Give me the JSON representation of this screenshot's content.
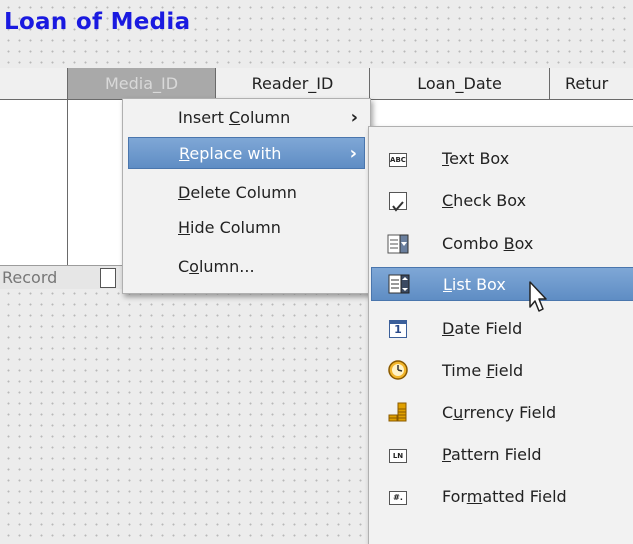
{
  "title": "Loan of Media",
  "grid": {
    "columns": [
      "Media_ID",
      "Reader_ID",
      "Loan_Date",
      "Retur"
    ],
    "record_label": "Record"
  },
  "context_menu": {
    "items": [
      {
        "label_pre": "Insert ",
        "key": "C",
        "label_post": "olumn",
        "has_submenu": true
      },
      {
        "label_pre": "",
        "key": "R",
        "label_post": "eplace with",
        "has_submenu": true
      },
      {
        "label_pre": "",
        "key": "D",
        "label_post": "elete Column",
        "has_submenu": false
      },
      {
        "label_pre": "",
        "key": "H",
        "label_post": "ide Column",
        "has_submenu": false
      },
      {
        "label_pre": "C",
        "key": "o",
        "label_post": "lumn...",
        "has_submenu": false
      }
    ]
  },
  "submenu": {
    "items": [
      {
        "icon": "text-box-icon",
        "label_pre": "",
        "key": "T",
        "label_post": "ext Box"
      },
      {
        "icon": "check-box-icon",
        "label_pre": "",
        "key": "C",
        "label_post": "heck Box"
      },
      {
        "icon": "combo-box-icon",
        "label_pre": "Combo ",
        "key": "B",
        "label_post": "ox"
      },
      {
        "icon": "list-box-icon",
        "label_pre": "",
        "key": "L",
        "label_post": "ist Box"
      },
      {
        "icon": "date-field-icon",
        "label_pre": "",
        "key": "D",
        "label_post": "ate Field"
      },
      {
        "icon": "time-field-icon",
        "label_pre": "Time ",
        "key": "F",
        "label_post": "ield"
      },
      {
        "icon": "currency-field-icon",
        "label_pre": "C",
        "key": "u",
        "label_post": "rrency Field"
      },
      {
        "icon": "pattern-field-icon",
        "label_pre": "",
        "key": "P",
        "label_post": "attern Field"
      },
      {
        "icon": "formatted-field-icon",
        "label_pre": "For",
        "key": "m",
        "label_post": "atted Field"
      }
    ]
  },
  "icon_text": {
    "text_box": "ABC",
    "date": "1",
    "pattern": "LN",
    "formatted": "#."
  },
  "colors": {
    "title": "#1a1ae0",
    "highlight": "#5f8dc4",
    "header_selected": "#a9a9a9"
  }
}
